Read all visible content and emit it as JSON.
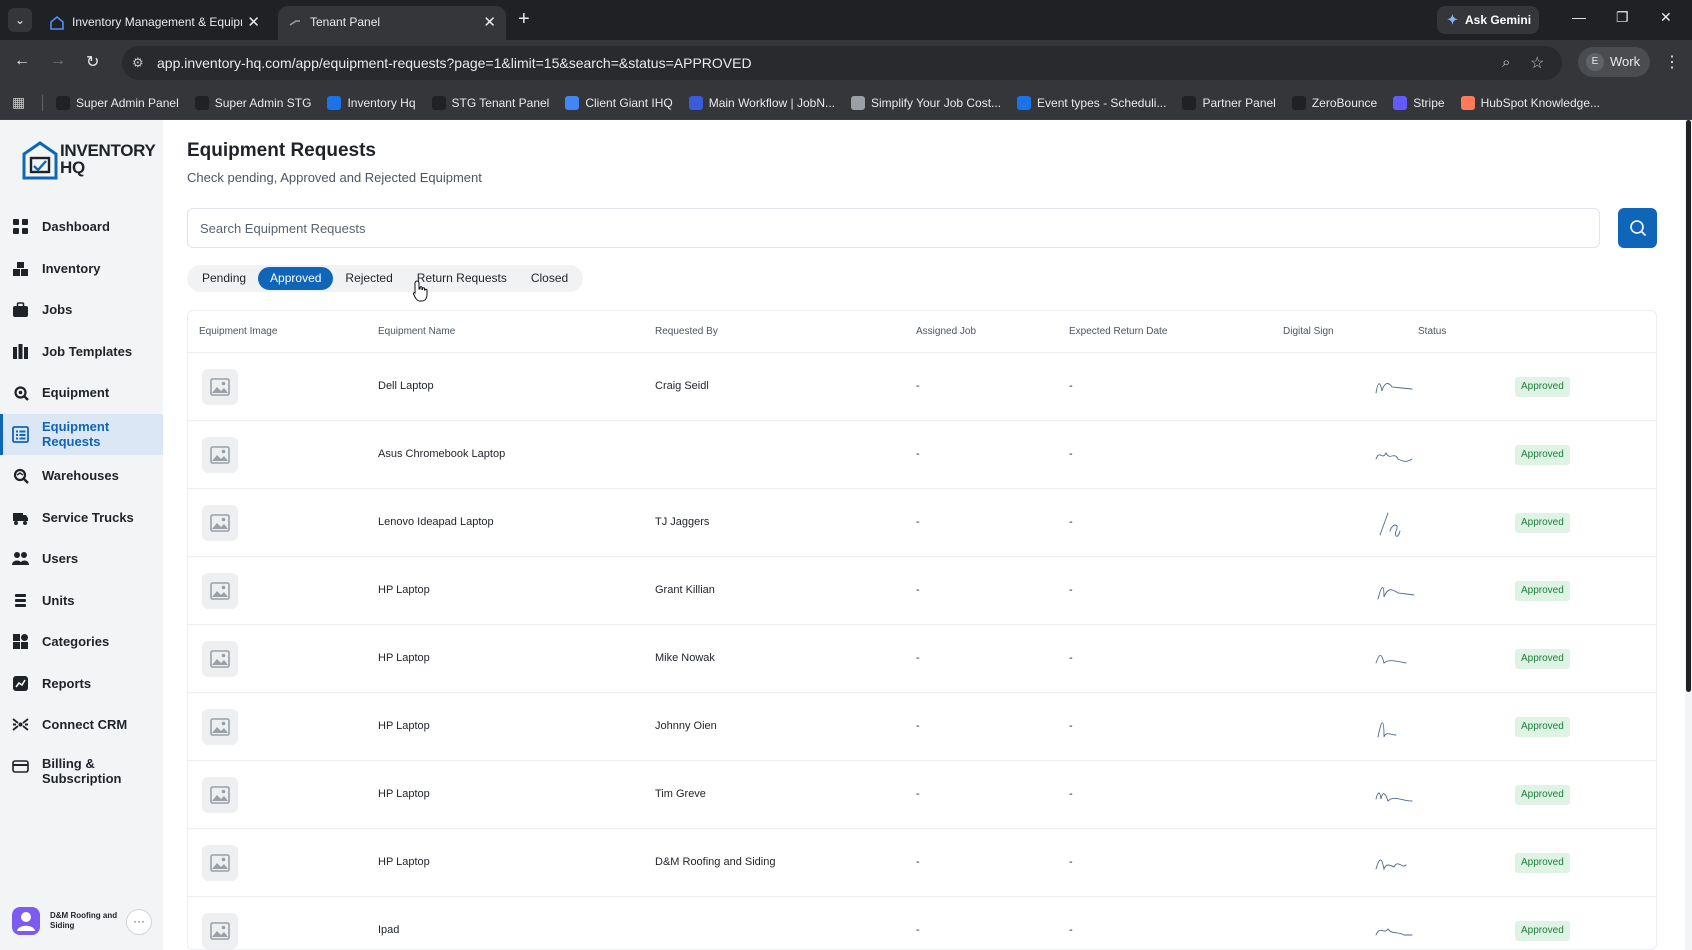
{
  "browser": {
    "tabs": [
      {
        "title": "Inventory Management & Equipm",
        "active": false
      },
      {
        "title": "Tenant Panel",
        "active": true
      }
    ],
    "gemini_label": "Ask Gemini",
    "url": "app.inventory-hq.com/app/equipment-requests?page=1&limit=15&search=&status=APPROVED",
    "profile_initial": "E",
    "profile_label": "Work",
    "bookmarks": [
      {
        "label": "Super Admin Panel",
        "color": "#202124"
      },
      {
        "label": "Super Admin STG",
        "color": "#202124"
      },
      {
        "label": "Inventory Hq",
        "color": "#1a73e8"
      },
      {
        "label": "STG Tenant Panel",
        "color": "#202124"
      },
      {
        "label": "Client Giant IHQ",
        "color": "#4285f4"
      },
      {
        "label": "Main Workflow | JobN...",
        "color": "#3b5bdb"
      },
      {
        "label": "Simplify Your Job Cost...",
        "color": "#9aa0a6"
      },
      {
        "label": "Event types - Scheduli...",
        "color": "#1a73e8"
      },
      {
        "label": "Partner Panel",
        "color": "#202124"
      },
      {
        "label": "ZeroBounce",
        "color": "#202124"
      },
      {
        "label": "Stripe",
        "color": "#635bff"
      },
      {
        "label": "HubSpot Knowledge...",
        "color": "#ff7a59"
      }
    ]
  },
  "sidebar": {
    "logo_line1": "INVENTORY",
    "logo_line2": "HQ",
    "items": [
      {
        "label": "Dashboard",
        "icon": "grid-icon",
        "active": false
      },
      {
        "label": "Inventory",
        "icon": "boxes-icon",
        "active": false
      },
      {
        "label": "Jobs",
        "icon": "briefcase-icon",
        "active": false
      },
      {
        "label": "Job Templates",
        "icon": "template-icon",
        "active": false
      },
      {
        "label": "Equipment",
        "icon": "gear-wrench-icon",
        "active": false
      },
      {
        "label": "Equipment Requests",
        "icon": "clipboard-list-icon",
        "active": true
      },
      {
        "label": "Warehouses",
        "icon": "warehouse-icon",
        "active": false
      },
      {
        "label": "Service Trucks",
        "icon": "truck-icon",
        "active": false
      },
      {
        "label": "Users",
        "icon": "users-icon",
        "active": false
      },
      {
        "label": "Units",
        "icon": "units-icon",
        "active": false
      },
      {
        "label": "Categories",
        "icon": "categories-icon",
        "active": false
      },
      {
        "label": "Reports",
        "icon": "reports-icon",
        "active": false
      },
      {
        "label": "Connect CRM",
        "icon": "crm-icon",
        "active": false
      },
      {
        "label": "Billing & Subscription",
        "icon": "card-icon",
        "active": false
      }
    ],
    "org_name": "D&M Roofing and Siding",
    "org_more": "···"
  },
  "page": {
    "title": "Equipment Requests",
    "subtitle": "Check pending, Approved and Rejected Equipment",
    "search_placeholder": "Search Equipment Requests",
    "search_value": "",
    "status_tabs": [
      "Pending",
      "Approved",
      "Rejected",
      "Return Requests",
      "Closed"
    ],
    "active_tab": "Approved"
  },
  "table": {
    "columns": [
      "Equipment Image",
      "Equipment Name",
      "Requested By",
      "Assigned Job",
      "Expected Return Date",
      "Digital Sign",
      "Status"
    ],
    "rows": [
      {
        "name": "Dell Laptop",
        "requested_by": "Craig Seidl",
        "job": "-",
        "return_date": "-",
        "status": "Approved"
      },
      {
        "name": "Asus Chromebook Laptop",
        "requested_by": "",
        "job": "-",
        "return_date": "-",
        "status": "Approved"
      },
      {
        "name": "Lenovo Ideapad Laptop",
        "requested_by": "TJ Jaggers",
        "job": "-",
        "return_date": "-",
        "status": "Approved"
      },
      {
        "name": "HP Laptop",
        "requested_by": "Grant Killian",
        "job": "-",
        "return_date": "-",
        "status": "Approved"
      },
      {
        "name": "HP Laptop",
        "requested_by": "Mike Nowak",
        "job": "-",
        "return_date": "-",
        "status": "Approved"
      },
      {
        "name": "HP Laptop",
        "requested_by": "Johnny Oien",
        "job": "-",
        "return_date": "-",
        "status": "Approved"
      },
      {
        "name": "HP Laptop",
        "requested_by": "Tim Greve",
        "job": "-",
        "return_date": "-",
        "status": "Approved"
      },
      {
        "name": "HP Laptop",
        "requested_by": "D&M Roofing and Siding",
        "job": "-",
        "return_date": "-",
        "status": "Approved"
      },
      {
        "name": "Ipad",
        "requested_by": "",
        "job": "-",
        "return_date": "-",
        "status": "Approved"
      }
    ]
  },
  "colors": {
    "primary": "#0f66b8",
    "approved_bg": "#dff3e4",
    "approved_text": "#1a7f37"
  }
}
